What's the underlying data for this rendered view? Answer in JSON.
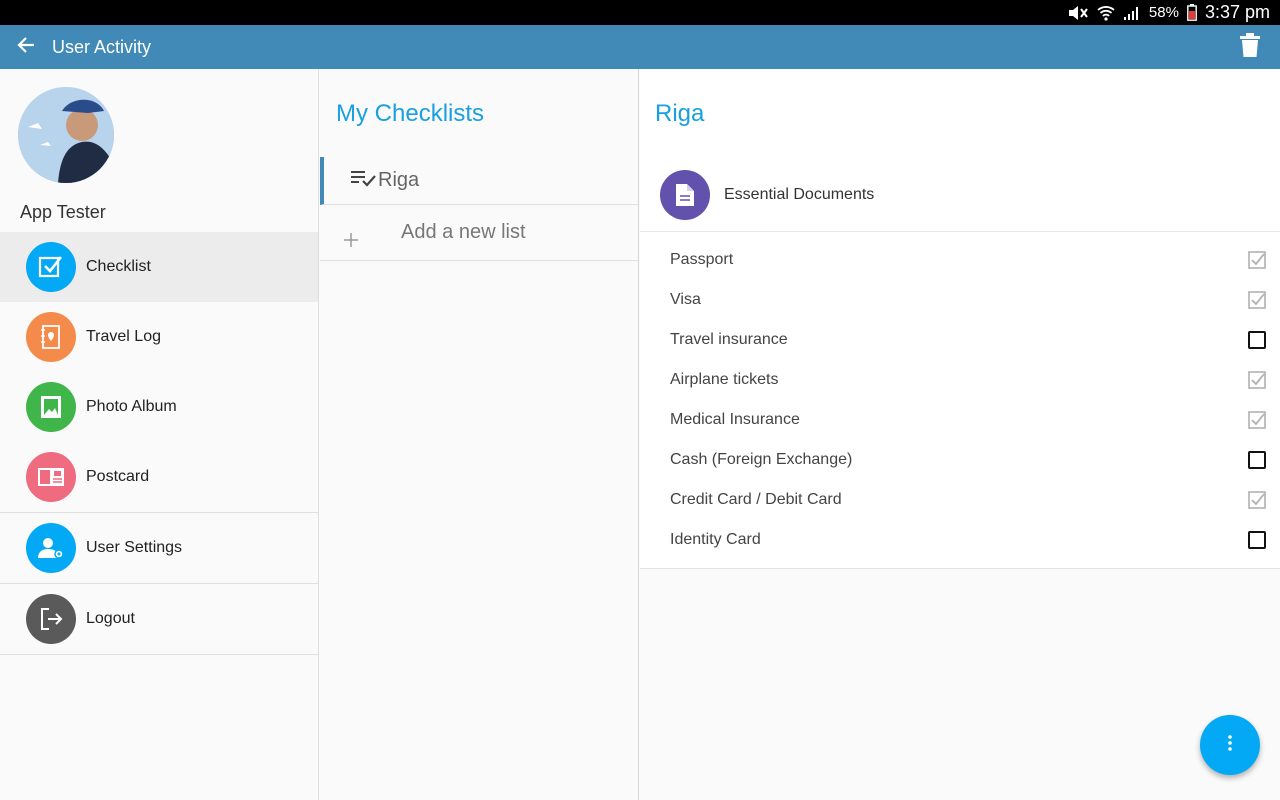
{
  "status_bar": {
    "battery": "58%",
    "time": "3:37 pm",
    "icons": [
      "mute-icon",
      "wifi-icon",
      "signal-icon",
      "battery-icon"
    ]
  },
  "app_bar": {
    "title": "User Activity",
    "back_icon": "arrow-left-icon",
    "action_icon": "trash-icon"
  },
  "drawer": {
    "username": "App Tester",
    "items": [
      {
        "label": "Checklist",
        "icon": "checkbox-icon",
        "color": "#03a9f4",
        "active": true
      },
      {
        "label": "Travel Log",
        "icon": "map-book-icon",
        "color": "#f58b4b"
      },
      {
        "label": "Photo Album",
        "icon": "photo-icon",
        "color": "#3fb54a"
      },
      {
        "label": "Postcard",
        "icon": "postcard-icon",
        "color": "#ee6b80"
      },
      {
        "label": "User Settings",
        "icon": "user-settings-icon",
        "color": "#03a9f4"
      },
      {
        "label": "Logout",
        "icon": "logout-icon",
        "color": "#5a5a5a"
      }
    ]
  },
  "checklists": {
    "heading": "My Checklists",
    "lists": [
      {
        "label": "Riga",
        "icon": "list-check-icon",
        "selected": true
      }
    ],
    "add_label": "Add a new list"
  },
  "detail": {
    "heading": "Riga",
    "category": {
      "label": "Essential Documents",
      "icon": "document-icon",
      "color": "#6251ad"
    },
    "items": [
      {
        "label": "Passport",
        "checked": true
      },
      {
        "label": "Visa",
        "checked": true
      },
      {
        "label": "Travel insurance",
        "checked": false
      },
      {
        "label": "Airplane tickets",
        "checked": true
      },
      {
        "label": "Medical Insurance",
        "checked": true
      },
      {
        "label": "Cash (Foreign Exchange)",
        "checked": false
      },
      {
        "label": "Credit Card / Debit Card",
        "checked": true
      },
      {
        "label": "Identity Card",
        "checked": false
      }
    ]
  },
  "fab": {
    "icon": "more-vert-icon",
    "color": "#03a9f4"
  }
}
